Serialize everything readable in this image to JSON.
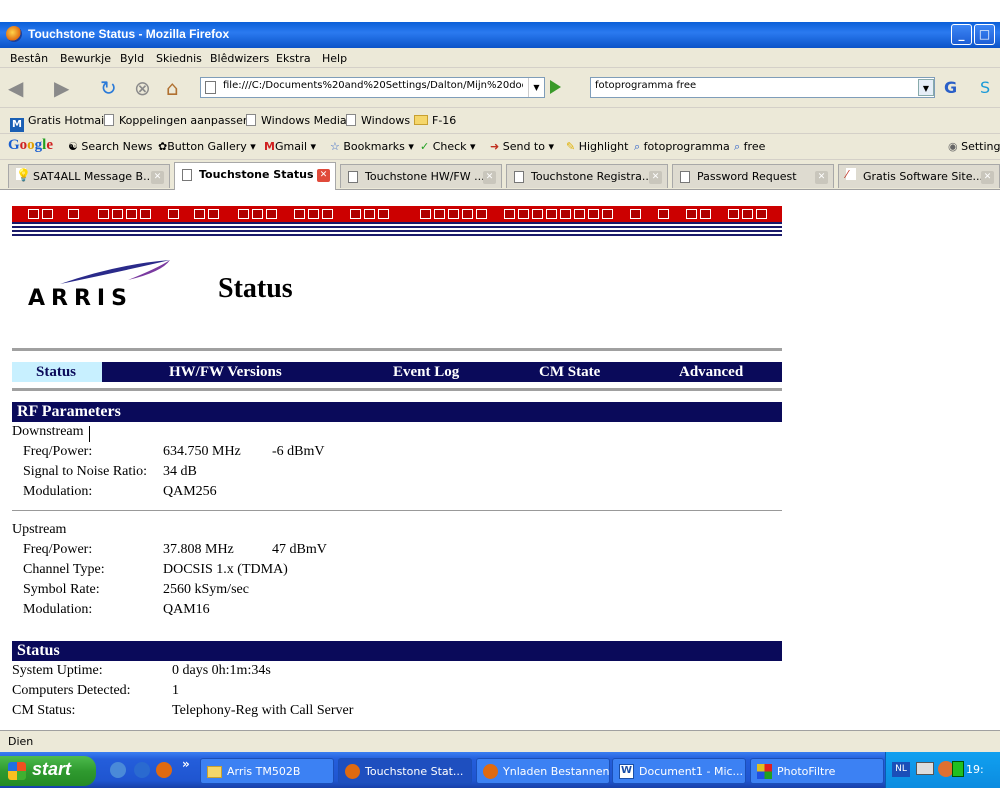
{
  "window": {
    "title": "Touchstone Status - Mozilla Firefox"
  },
  "menu": [
    "Bestân",
    "Bewurkje",
    "Byld",
    "Skiednis",
    "Blêdwizers",
    "Ekstra",
    "Help"
  ],
  "nav": {
    "url": "file:///C:/Documents%20and%20Settings/Dalton/Mijn%20doc",
    "search": "fotoprogramma free"
  },
  "bookmarks": [
    "Gratis Hotmail",
    "Koppelingen aanpassen",
    "Windows Media",
    "Windows",
    "F-16"
  ],
  "googlebar": {
    "logo": "Google",
    "items": [
      "Search News",
      "Button Gallery",
      "Gmail",
      "Bookmarks",
      "Check",
      "Send to",
      "Highlight",
      "fotoprogramma",
      "free",
      "Setting"
    ]
  },
  "tabs": [
    "SAT4ALL Message B...",
    "Touchstone Status",
    "Touchstone HW/FW ...",
    "Touchstone Registra...",
    "Password Request",
    "Gratis Software Site..."
  ],
  "page": {
    "brand": "ARRIS",
    "title": "Status",
    "navtabs": [
      "Status",
      "HW/FW Versions",
      "Event Log",
      "CM State",
      "Advanced"
    ],
    "rf": {
      "heading": "RF Parameters",
      "downstream": {
        "label": "Downstream",
        "freq_label": "Freq/Power:",
        "freq": "634.750 MHz",
        "power": "-6 dBmV",
        "snr_label": "Signal to Noise Ratio:",
        "snr": "34 dB",
        "mod_label": "Modulation:",
        "mod": "QAM256"
      },
      "upstream": {
        "label": "Upstream",
        "freq_label": "Freq/Power:",
        "freq": "37.808 MHz",
        "power": "47 dBmV",
        "chan_label": "Channel Type:",
        "chan": "DOCSIS 1.x (TDMA)",
        "rate_label": "Symbol Rate:",
        "rate": "2560 kSym/sec",
        "mod_label": "Modulation:",
        "mod": "QAM16"
      }
    },
    "status": {
      "heading": "Status",
      "uptime_label": "System Uptime:",
      "uptime": "0 days 0h:1m:34s",
      "computers_label": "Computers Detected:",
      "computers": "1",
      "cm_label": "CM Status:",
      "cm": "Telephony-Reg with Call Server"
    }
  },
  "statusbar": "Dien",
  "taskbar": {
    "start": "start",
    "tasks": [
      "Arris TM502B",
      "Touchstone Stat...",
      "Ynladen Bestannen",
      "Document1 - Mic...",
      "PhotoFiltre"
    ],
    "lang": "NL",
    "clock": "19:"
  },
  "colors": {
    "navy": "#0a0a5a",
    "banner_red": "#cc0000",
    "active_tab": "#c8f0ff"
  }
}
